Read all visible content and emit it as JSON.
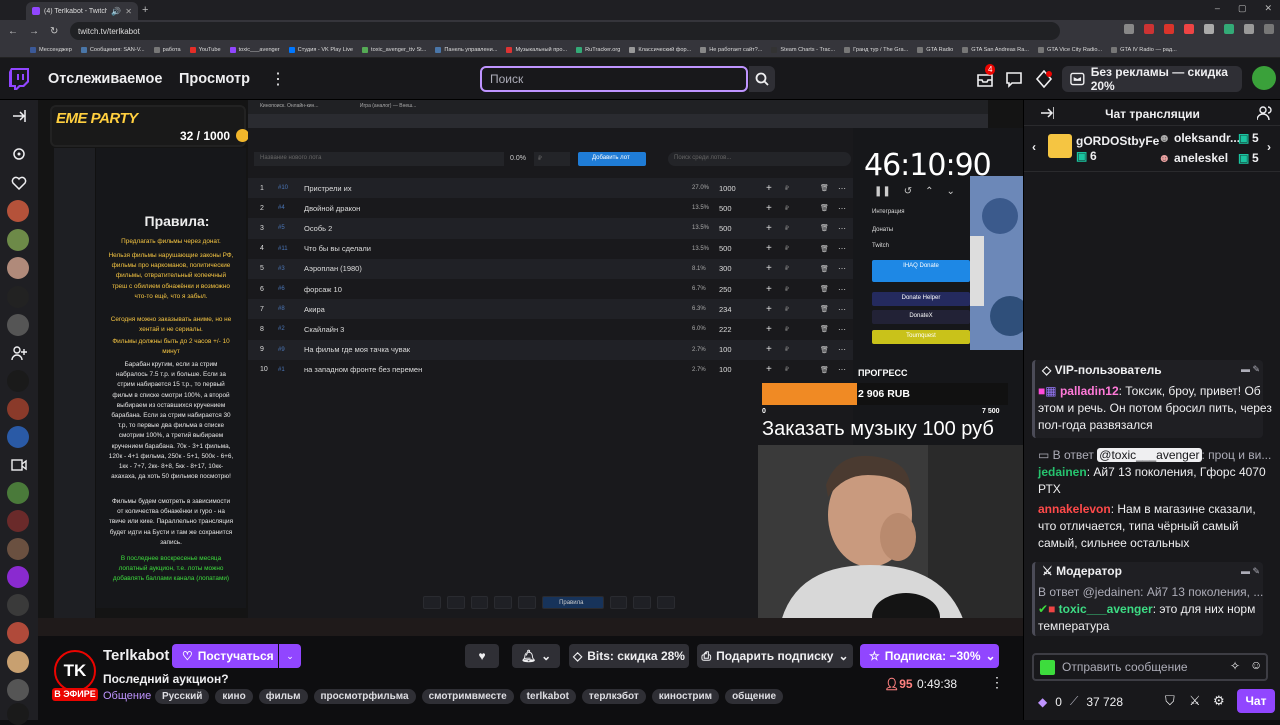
{
  "browser": {
    "tab_title": "(4) Terlkabot - Twitch",
    "url": "twitch.tv/terlkabot",
    "bookmarks": [
      "Мессенджер",
      "Сообщения: SAN-V...",
      "работа",
      "YouTube",
      "toxic___avenger",
      "Студия - VK Play Live",
      "toxic_avenger_ttv St...",
      "Панель управлени...",
      "Музыкальный про...",
      "RuTracker.org",
      "Классический фор...",
      "Не работает сайт?...",
      "Steam Charts - Trac...",
      "Гранд тур / The Gra...",
      "GTA Radio",
      "GTA San Andreas Ra...",
      "GTA Vice City Radio...",
      "GTA IV Radio — рад..."
    ]
  },
  "nav": {
    "following": "Отслеживаемое",
    "browse": "Просмотр",
    "search_placeholder": "Поиск",
    "notif_count": "4",
    "adfree_label": "Без рекламы — скидка 20%"
  },
  "stream": {
    "overlay_title": "EME PARTY",
    "overlay_count": "32 / 1000",
    "app_titlebar_tabs": [
      "Кинопоиск. Онлайн-кин...",
      "Игра (аналог) — Внеш..."
    ],
    "rules_title": "Правила:",
    "rules": [
      {
        "text": "Предлагать фильмы через донат.",
        "color": "#f5c542"
      },
      {
        "text": "Нельзя фильмы нарушающие законы РФ, фильмы про наркоманов, политические фильмы, отвратительный копеечный треш с обилием обнажёнки и возможно что-то ещё, что я забыл.",
        "color": "#f5c542"
      },
      {
        "text": "Сегодня можно заказывать аниме, но не хентай и не сериалы.",
        "color": "#f5c542"
      },
      {
        "text": "Фильмы должны быть до 2 часов +/- 10 минут",
        "color": "#f5c542"
      },
      {
        "text": "Барабан крутим, если за стрим набралось 7.5 т.р. и больше. Если за стрим набирается 15 т.р., то первый фильм в списке смотри 100%, а второй выбираем из оставшихся кручением барабана. Если за стрим набирается 30 т.р, то первые два фильма в списке смотрим 100%, а третий выбираем кручением барабана. 70к - 3+1 фильма, 120к - 4+1 фильма, 250к - 5+1, 500к - 6+6, 1кк - 7+7, 2кк- 8+8, 5кк - 8+17, 10кк-ахахаха, да хоть 50 фильмов посмотрю!",
        "color": "#e8e8e8"
      },
      {
        "text": "Фильмы будем смотреть в зависимости от количества обнажёнки и гуро - на твиче или кике. Параллельно трансляция будет идти на Бусти и там же сохранится запись.",
        "color": "#e8e8e8"
      },
      {
        "text": "В последнее воскресенье месяца лопатный аукцион, т.е. лоты можно добавлять баллами канала (лопатами)",
        "color": "#3ddc3d"
      }
    ],
    "new_lot_placeholder": "Название нового лота",
    "percent_label": "0.0%",
    "rub_placeholder": "₽",
    "add_lot_label": "Добавить лот",
    "search_lots_placeholder": "Поиск среди лотов...",
    "lots": [
      {
        "n": "1",
        "id": "#10",
        "name": "Пристрели их",
        "pct": "27.0%",
        "amount": "1000"
      },
      {
        "n": "2",
        "id": "#4",
        "name": "Двойной дракон",
        "pct": "13.5%",
        "amount": "500"
      },
      {
        "n": "3",
        "id": "#5",
        "name": "Особь 2",
        "pct": "13.5%",
        "amount": "500"
      },
      {
        "n": "4",
        "id": "#11",
        "name": "Что бы вы сделали",
        "pct": "13.5%",
        "amount": "500"
      },
      {
        "n": "5",
        "id": "#3",
        "name": "Аэроплан (1980)",
        "pct": "8.1%",
        "amount": "300"
      },
      {
        "n": "6",
        "id": "#6",
        "name": "форсаж 10",
        "pct": "6.7%",
        "amount": "250"
      },
      {
        "n": "7",
        "id": "#8",
        "name": "Акира",
        "pct": "6.3%",
        "amount": "234"
      },
      {
        "n": "8",
        "id": "#2",
        "name": "Скайлайн 3",
        "pct": "6.0%",
        "amount": "222"
      },
      {
        "n": "9",
        "id": "#9",
        "name": "На фильм где моя тачка чувак",
        "pct": "2.7%",
        "amount": "100"
      },
      {
        "n": "10",
        "id": "#1",
        "name": "на западном фронте без перемен",
        "pct": "2.7%",
        "amount": "100"
      }
    ],
    "rules_btn": "Правила",
    "timer": "46:10:90",
    "integration_label": "Интеграция",
    "donations_label": "Донаты",
    "twitch_label": "Twitch",
    "services": [
      {
        "label": "IHAQ Donate",
        "color": "#1e88e5"
      },
      {
        "label": "Donate Helper",
        "color": "#242a5e"
      },
      {
        "label": "DonateX",
        "color": "#222236"
      },
      {
        "label": "Tournquest",
        "color": "#c9c21a"
      }
    ],
    "progress_label": "ПРОГРЕСС",
    "progress_amount": "2 906 RUB",
    "progress_min": "0",
    "progress_max": "7 500",
    "progress_value": 2906,
    "progress_goal": 7500,
    "music_text": "Заказать музыку 100 руб"
  },
  "channel": {
    "avatar_text": "TK",
    "live": "В ЭФИРЕ",
    "name": "Terlkabot",
    "follow": "Постучаться",
    "title": "Последний аукцион?",
    "category": "Общение",
    "tags": [
      "Русский",
      "кино",
      "фильм",
      "просмотрфильма",
      "смотримвместе",
      "terlkabot",
      "терлкэбот",
      "кинострим",
      "общение"
    ],
    "bits": "Bits: скидка 28%",
    "gift": "Подарить подписку",
    "subscribe": "Подписка: −30%",
    "viewers": "95",
    "uptime": "0:49:38"
  },
  "chat": {
    "title": "Чат трансляции",
    "gifters": [
      {
        "name": "gORDOStbyFe",
        "count": "6"
      },
      {
        "name": "oleksandr...",
        "count": "5"
      },
      {
        "name": "aneleskel",
        "count": "5"
      }
    ],
    "vip_header": "VIP-пользователь",
    "msg1_name": "palladin12",
    "msg1_text": ": Токсик, броу, привет! Об этом и речь. Он потом бросил пить, через пол-года развязался",
    "msg2_reply_prefix": "В ответ ",
    "msg2_reply_mention": "@toxic___avenger",
    "msg2_reply_rest": ": проц и ви...",
    "msg2_name": "jedainen",
    "msg2_text": ": Ай7 13 поколения, Гфорс 4070 РТХ",
    "msg3_name": "annakelevon",
    "msg3_text": ": Нам в магазине сказали, что отличается, типа чёрный самый самый, сильнее остальных",
    "mod_header": "Модератор",
    "msg4_reply": "В ответ @jedainen: Ай7 13 поколения, ...",
    "msg4_name": "toxic___avenger",
    "msg4_text": ": это для них норм температура",
    "input_placeholder": "Отправить сообщение",
    "points": "0",
    "channel_points": "37 728",
    "send": "Чат"
  }
}
